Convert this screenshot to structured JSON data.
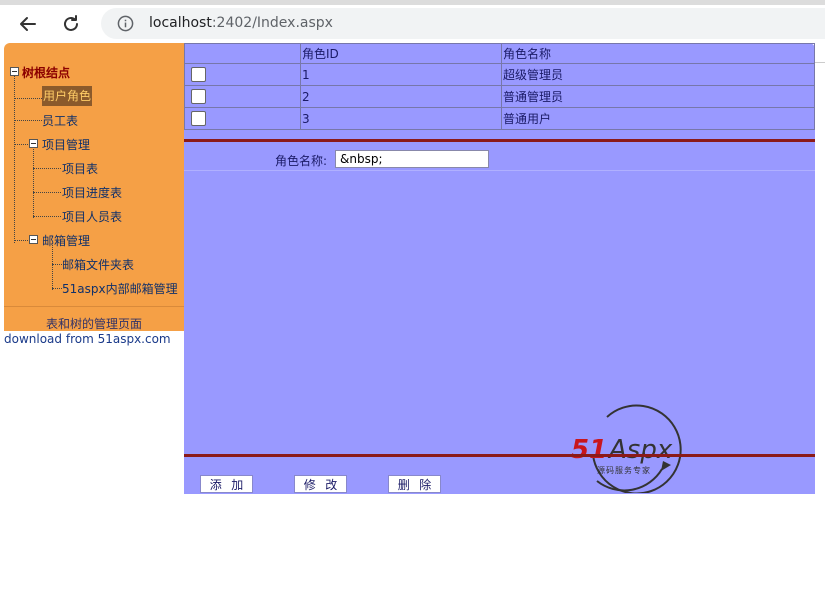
{
  "browser": {
    "url_host": "localhost",
    "url_rest": ":2402/Index.aspx"
  },
  "tree": {
    "root": "树根结点",
    "items": {
      "user_roles": "用户角色",
      "employee_table": "员工表",
      "project_mgmt": "项目管理",
      "project_table": "项目表",
      "project_progress": "项目进度表",
      "project_staff": "项目人员表",
      "mail_mgmt": "邮箱管理",
      "mail_folder": "邮箱文件夹表",
      "internal_mail": "51aspx内部邮箱管理"
    },
    "footer": "表和树的管理页面"
  },
  "download_text": "download from 51aspx.com",
  "grid": {
    "columns": [
      "",
      "角色ID",
      "角色名称"
    ],
    "rows": [
      {
        "id": "1",
        "name": "超级管理员"
      },
      {
        "id": "2",
        "name": "普通管理员"
      },
      {
        "id": "3",
        "name": "普通用户"
      }
    ]
  },
  "form": {
    "label": "角色名称:",
    "value": "&nbsp;"
  },
  "actions": {
    "add": [
      "添",
      "加"
    ],
    "edit": [
      "修",
      "改"
    ],
    "delete": [
      "删",
      "除"
    ]
  },
  "logo": {
    "brand_51": "51",
    "brand_aspx": "Aspx",
    "tagline": "源码服务专家"
  },
  "colors": {
    "tree_bg": "#f5a046",
    "main_bg": "#9999ff",
    "separator": "#8b1a1a"
  }
}
